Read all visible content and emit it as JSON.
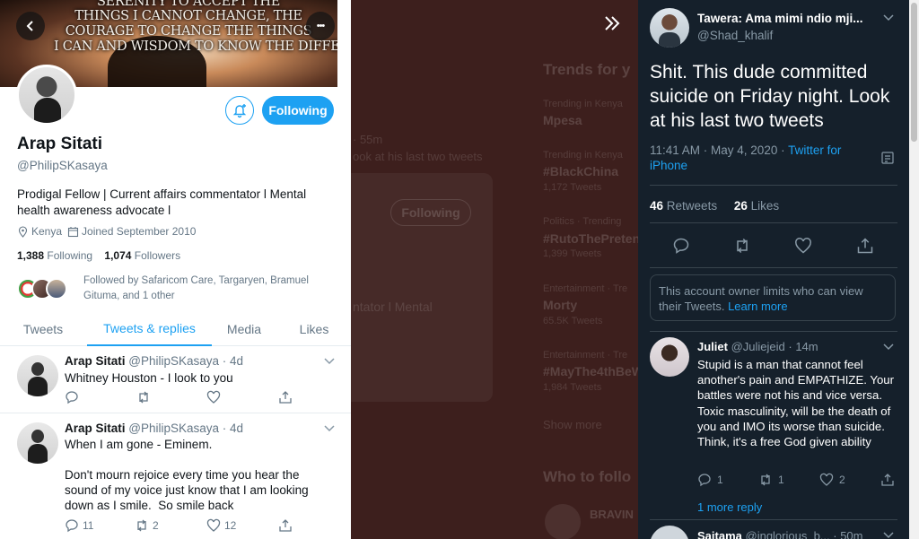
{
  "profile": {
    "banner_quote_lines": [
      "SERENITY TO ACCEPT THE",
      "THINGS I CANNOT CHANGE, THE",
      "COURAGE TO CHANGE THE THINGS",
      "I CAN AND WISDOM TO KNOW THE DIFFERENCE."
    ],
    "name": "Arap Sitati",
    "handle": "@PhilipSKasaya",
    "bio": "Prodigal Fellow | Current affairs commentator l Mental health awareness advocate l",
    "location": "Kenya",
    "joined": "Joined September 2010",
    "following_count": "1,388",
    "following_label": "Following",
    "followers_count": "1,074",
    "followers_label": "Followers",
    "followed_by": "Followed by Safaricom Care, Targaryen, Bramuel Gituma, and 1 other",
    "follow_button": "Following",
    "more_button": "•••"
  },
  "tabs": [
    "Tweets",
    "Tweets & replies",
    "Media",
    "Likes"
  ],
  "active_tab": "Tweets & replies",
  "tweets": [
    {
      "name": "Arap Sitati",
      "meta": "@PhilipSKasaya · 4d",
      "text": "Whitney Houston - I look to you",
      "replies": "",
      "retweets": "",
      "likes": ""
    },
    {
      "name": "Arap Sitati",
      "meta": "@PhilipSKasaya · 4d",
      "text": "When I am gone - Eminem.\n\nDon't mourn rejoice every time you hear the sound of my voice just know that I am looking down as I smile.  So smile back",
      "replies": "11",
      "retweets": "2",
      "likes": "12"
    }
  ],
  "background": {
    "trends_title": "Trends for y",
    "trends": [
      {
        "context": "Trending in Kenya",
        "tag": "Mpesa",
        "count": ""
      },
      {
        "context": "Trending in Kenya",
        "tag": "#BlackChina",
        "count": "1,172 Tweets"
      },
      {
        "context": "Politics · Trending",
        "tag": "#RutoThePreten",
        "count": "1,399 Tweets"
      },
      {
        "context": "Entertainment · Tre",
        "tag": "Morty",
        "count": "65.5K Tweets"
      },
      {
        "context": "Entertainment · Tre",
        "tag": "#MayThe4thBeW",
        "count": "1,984 Tweets"
      }
    ],
    "show_more": "Show more",
    "who_to_follow": "Who to follo",
    "suggested": "BRAVIN",
    "card_time": "· 55m",
    "card_text": "ook at his last two tweets",
    "card_button": "Following",
    "card_bio": "ntator l Mental"
  },
  "detail": {
    "name": "Tawera: Ama mimi ndio mji...",
    "handle": "@Shad_khalif",
    "text": "Shit. This dude committed suicide on Friday night. Look at his last two tweets",
    "time": "11:41 AM · May 4, 2020 · ",
    "source": "Twitter for iPhone",
    "retweets_count": "46",
    "retweets_label": "Retweets",
    "likes_count": "26",
    "likes_label": "Likes",
    "limit_notice": "This account owner limits who can view their Tweets. ",
    "learn_more": "Learn more"
  },
  "reply": {
    "name": "Juliet",
    "meta": "@Juliejeid · 14m",
    "text": "Stupid is a man that cannot feel another's pain and EMPATHIZE. Your battles were not his and vice versa. Toxic masculinity, will be the death of you and IMO its worse than suicide. Think, it's a free God given ability",
    "replies": "1",
    "retweets": "1",
    "likes": "2",
    "more_replies": "1 more reply"
  },
  "next_reply": {
    "name": "Saitama",
    "meta": "@inglorious_b... · 50m"
  },
  "colors": {
    "accent": "#1da1f2",
    "dark_bg": "#15202b",
    "overlay_bg": "#3d1f1d"
  }
}
